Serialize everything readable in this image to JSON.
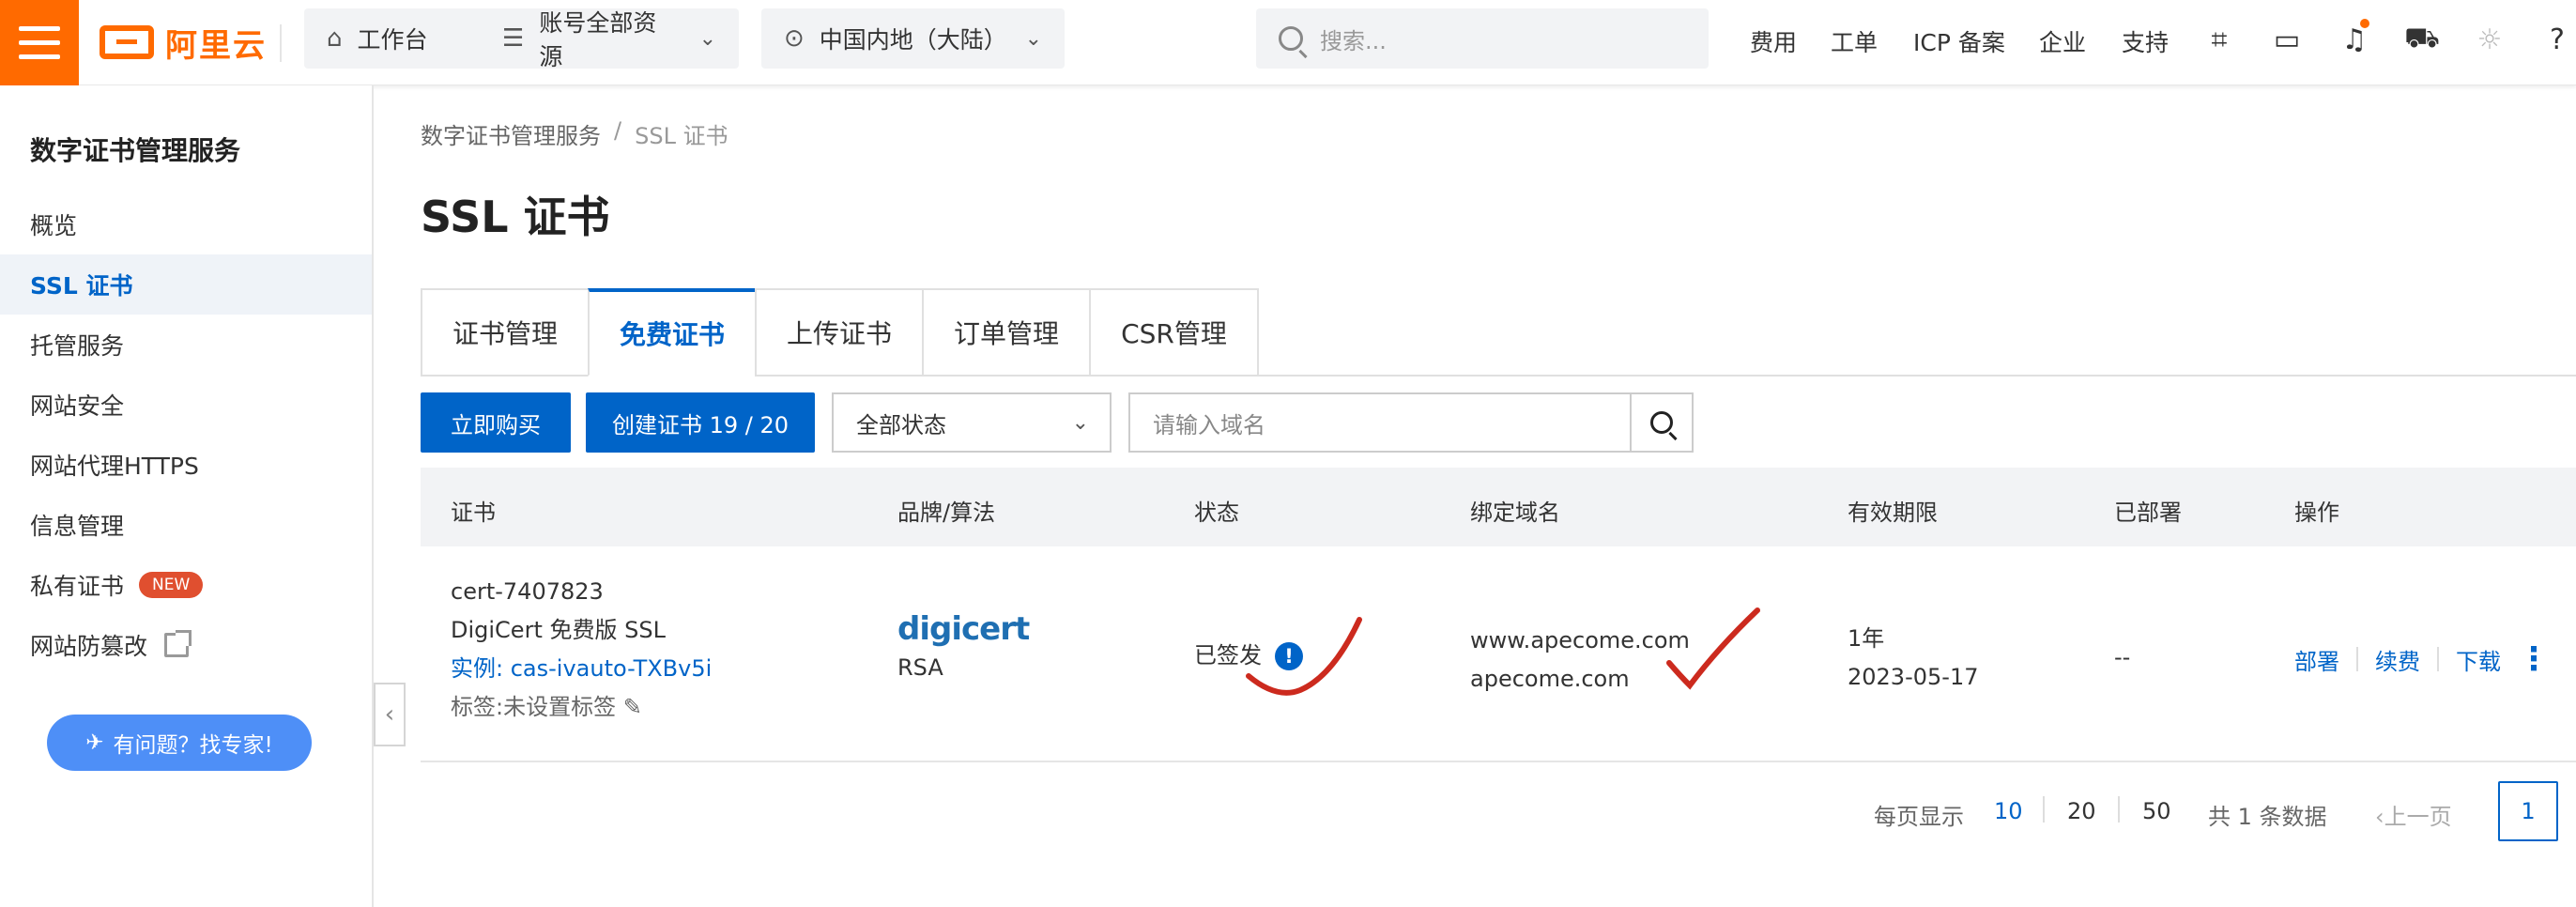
{
  "topbar": {
    "logo_text": "阿里云",
    "workbench": "工作台",
    "resources": "账号全部资源",
    "region": "中国内地（大陆）",
    "search_placeholder": "搜索...",
    "nav": [
      "费用",
      "工单",
      "ICP 备案",
      "企业",
      "支持"
    ],
    "brand_color": "#ff6a00"
  },
  "sidebar": {
    "title": "数字证书管理服务",
    "items": [
      {
        "label": "概览"
      },
      {
        "label": "SSL 证书"
      },
      {
        "label": "托管服务"
      },
      {
        "label": "网站安全"
      },
      {
        "label": "网站代理HTTPS"
      },
      {
        "label": "信息管理"
      },
      {
        "label": "私有证书",
        "badge": "NEW"
      },
      {
        "label": "网站防篡改"
      }
    ],
    "ask_button": "有问题？找专家!"
  },
  "breadcrumb": {
    "root": "数字证书管理服务",
    "sep": "/",
    "current": "SSL 证书"
  },
  "page_title": "SSL 证书",
  "tabs": [
    "证书管理",
    "免费证书",
    "上传证书",
    "订单管理",
    "CSR管理"
  ],
  "toolbar": {
    "buy_label": "立即购买",
    "create_label": "创建证书 19 / 20",
    "status_select": "全部状态",
    "domain_placeholder": "请输入域名"
  },
  "table": {
    "headers": [
      "证书",
      "品牌/算法",
      "状态",
      "绑定域名",
      "有效期限",
      "已部署",
      "操作"
    ],
    "rows": [
      {
        "cert_id": "cert-7407823",
        "cert_name": "DigiCert 免费版 SSL",
        "instance": "实例: cas-ivauto-TXBv5i",
        "tag": "标签:未设置标签",
        "brand": "digicert",
        "algo": "RSA",
        "status": "已签发",
        "status_info": "!",
        "domain1": "www.apecome.com",
        "domain2": "apecome.com",
        "term": "1年",
        "expiry": "2023-05-17",
        "deployed": "--",
        "actions": [
          "部署",
          "续费",
          "下载"
        ]
      }
    ]
  },
  "pagination": {
    "per_page_label": "每页显示",
    "sizes": [
      "10",
      "20",
      "50"
    ],
    "total": "共 1 条数据",
    "prev": "上一页",
    "current": "1"
  }
}
